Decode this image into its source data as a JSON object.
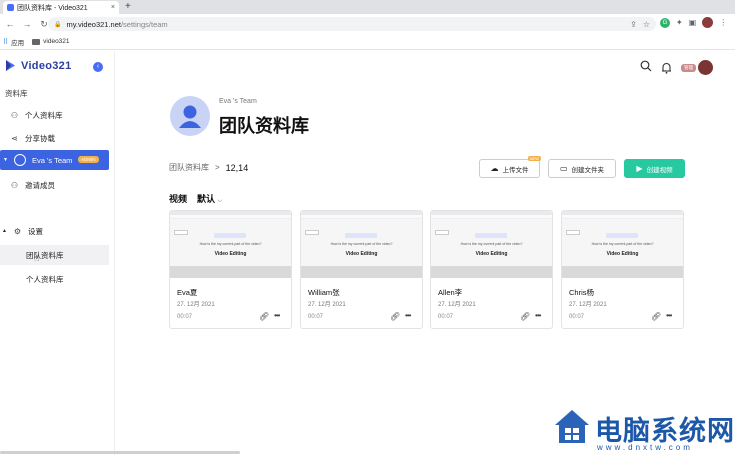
{
  "browser": {
    "tab_title": "团队资料库 - Video321",
    "tab_close": "×",
    "new_tab": "+",
    "url_host": "my.video321.net",
    "url_path": "/settings/team",
    "back": "←",
    "forward": "→",
    "reload": "↻",
    "lock": "🔒",
    "bookmarks": {
      "apps_label": "应用",
      "items": [
        "video321"
      ]
    }
  },
  "app": {
    "brand": "Video321",
    "collapse": "‹",
    "library_section": "资料库",
    "sidebar": {
      "personal_library": "个人资料库",
      "shared_comments": "分享协载",
      "team_name": "Eva 's Team",
      "team_badge": "ADMIN",
      "invite_members": "邀请成员",
      "settings": "设置",
      "team_library": "团队资料库",
      "personal_library_sub": "个人资料库"
    },
    "header": {
      "user_tag": "管理"
    },
    "hero": {
      "team_sub": "Eva 's Team",
      "title": "团队资料库"
    },
    "breadcrumb": {
      "root": "团队资料库",
      "separator": ">",
      "count": "12,14"
    },
    "actions": {
      "upload": "上传文件",
      "upload_badge": "NEW",
      "new_folder": "创建文件夹",
      "create_video": "创建视频"
    },
    "filter": {
      "videos": "视频",
      "sort": "默认",
      "sort_caret": "⌵"
    },
    "videos": [
      {
        "title": "Eva夏",
        "date": "27. 12月 2021",
        "duration": "00:07",
        "thumb_question": "How is the my current part of the video?",
        "thumb_headline": "Video Editing"
      },
      {
        "title": "William张",
        "date": "27. 12月 2021",
        "duration": "00:07",
        "thumb_question": "How is the my current part of the video?",
        "thumb_headline": "Video Editing"
      },
      {
        "title": "Allen李",
        "date": "27. 12月 2021",
        "duration": "00:07",
        "thumb_question": "How is the my current part of the video?",
        "thumb_headline": "Video Editing"
      },
      {
        "title": "Chris杨",
        "date": "27. 12月 2021",
        "duration": "00:07",
        "thumb_question": "How is the my current part of the video?",
        "thumb_headline": "Video Editing"
      }
    ]
  },
  "watermark": {
    "text": "电脑系统网",
    "url": "www.dnxtw.com"
  },
  "colors": {
    "accent": "#3c63e0",
    "primary_button": "#27c9a0",
    "brand": "#2c3e9e"
  }
}
